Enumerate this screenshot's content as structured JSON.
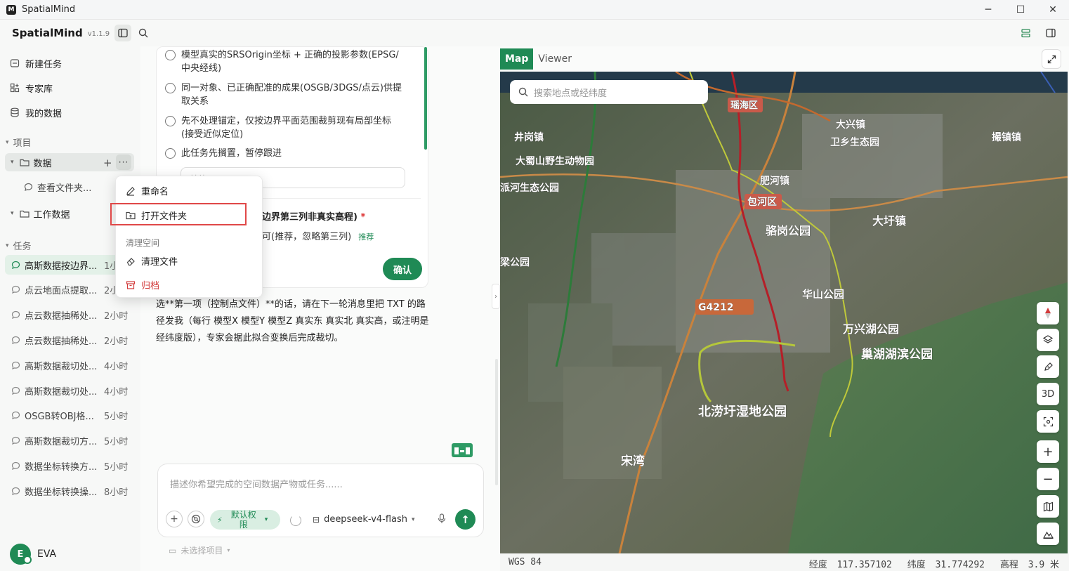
{
  "window": {
    "title": "SpatialMind",
    "minimize": "─",
    "maximize": "☐",
    "close": "✕"
  },
  "toolbar": {
    "brand": "SpatialMind",
    "version": "v1.1.9"
  },
  "sidebar": {
    "nav": [
      {
        "label": "新建任务"
      },
      {
        "label": "专家库"
      },
      {
        "label": "我的数据"
      }
    ],
    "projects_header": "项目",
    "projects": [
      {
        "label": "数据"
      },
      {
        "label": "工作数据"
      }
    ],
    "subfile": "查看文件夹...",
    "tasks_header": "任务",
    "tasks": [
      {
        "name": "高斯数据按边界...",
        "time": "1小时"
      },
      {
        "name": "点云地面点提取...",
        "time": "2小时"
      },
      {
        "name": "点云数据抽稀处...",
        "time": "2小时"
      },
      {
        "name": "点云数据抽稀处...",
        "time": "2小时"
      },
      {
        "name": "高斯数据裁切处...",
        "time": "4小时"
      },
      {
        "name": "高斯数据裁切处...",
        "time": "4小时"
      },
      {
        "name": "OSGB转OBJ格...",
        "time": "5小时"
      },
      {
        "name": "高斯数据裁切方...",
        "time": "5小时"
      },
      {
        "name": "数据坐标转换方...",
        "time": "5小时"
      },
      {
        "name": "数据坐标转换操...",
        "time": "8小时"
      }
    ],
    "user": {
      "initial": "E",
      "name": "EVA"
    }
  },
  "context_menu": {
    "rename": "重命名",
    "open_folder": "打开文件夹",
    "section": "清理空间",
    "clean": "清理文件",
    "archive": "归档"
  },
  "chat": {
    "options": [
      "模型真实的SRSOrigin坐标 + 正确的投影参数(EPSG/中央经线)",
      "同一对象、已正确配准的成果(OSGB/3DGS/点云)供提取关系",
      "先不处理锚定，仅按边界平面范围裁剪现有局部坐标(接受近似定位)",
      "此任务先搁置，暂停跟进"
    ],
    "other_placeholder": "其他",
    "q2_title": "边界第三列非真实高程)",
    "q2_required": "*",
    "q2_option": "可(推荐，忽略第三列)",
    "q2_tag": "推荐",
    "confirm": "确认",
    "message": "选**第一项（控制点文件）**的话，请在下一轮消息里把 TXT 的路径发我（每行 模型X 模型Y 模型Z 真实东 真实北 真实高，或注明是经纬度版），专家会据此拟合变换后完成裁切。",
    "composer_placeholder": "描述你希望完成的空间数据产物或任务......",
    "permission": "默认权限",
    "model": "deepseek-v4-flash",
    "project_selector": "未选择项目"
  },
  "map": {
    "tabs": [
      {
        "label": "Map"
      },
      {
        "label": "Viewer"
      }
    ],
    "search_placeholder": "搜索地点或经纬度",
    "controls": {
      "threed": "3D"
    },
    "labels": [
      "瑶海区",
      "大兴镇",
      "井岗镇",
      "卫乡生态园",
      "撮镇镇",
      "大蜀山野生动物园",
      "肥河镇",
      "派河生态公园",
      "包河区",
      "骆岗公园",
      "大圩镇",
      "梁公园",
      "G4212",
      "华山公园",
      "万兴湖公园",
      "巢湖湖滨公园",
      "北涝圩湿地公园",
      "宋湾"
    ],
    "status": {
      "crs": "WGS 84",
      "lon_label": "经度",
      "lon": "117.357102",
      "lat_label": "纬度",
      "lat": "31.774292",
      "alt_label": "高程",
      "alt": "3.9 米"
    }
  },
  "colors": {
    "accent": "#1f8a55",
    "danger": "#d23b3b",
    "highlight": "#e04848"
  }
}
